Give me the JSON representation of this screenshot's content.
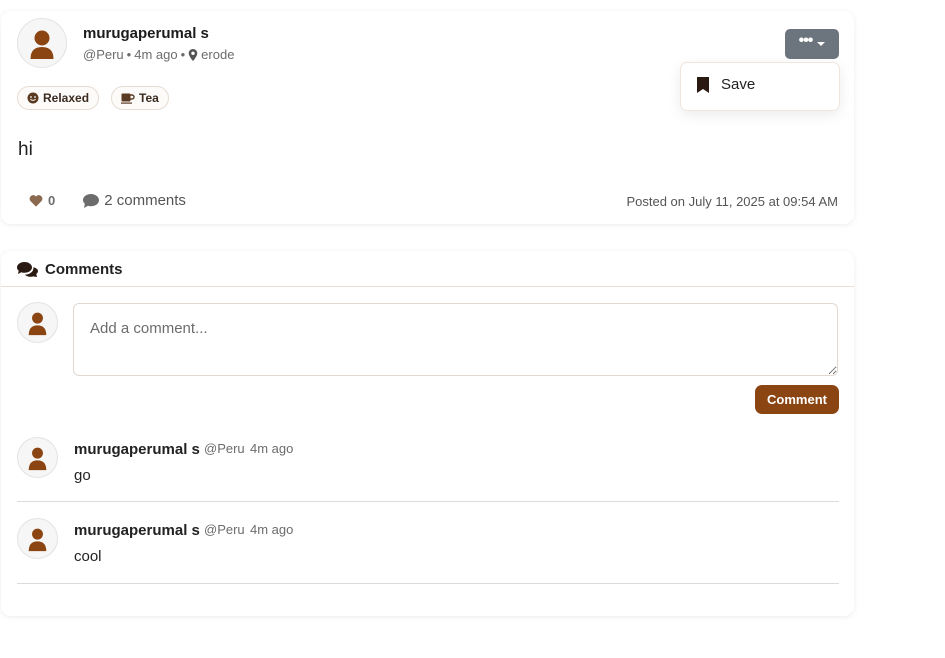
{
  "post": {
    "author_name": "murugaperumal s",
    "handle": "@Peru",
    "time_ago": "4m ago",
    "location": "erode",
    "separator": "•",
    "tags": [
      {
        "label": "Relaxed",
        "icon": "smile-icon"
      },
      {
        "label": "Tea",
        "icon": "mug-icon"
      }
    ],
    "body": "hi",
    "like_count": "0",
    "comments_label": "2 comments",
    "posted_on": "Posted on July 11, 2025 at 09:54 AM",
    "menu": {
      "button_icon": "ellipsis-icon",
      "save_label": "Save",
      "save_icon": "bookmark-icon"
    }
  },
  "comments_section": {
    "title": "Comments",
    "input_placeholder": "Add a comment...",
    "submit_label": "Comment",
    "items": [
      {
        "author_name": "murugaperumal s",
        "handle": "@Peru",
        "time_ago": "4m ago",
        "text": "go"
      },
      {
        "author_name": "murugaperumal s",
        "handle": "@Peru",
        "time_ago": "4m ago",
        "text": "cool"
      }
    ]
  },
  "colors": {
    "accent": "#8b4513",
    "secondary_button": "#6c757d",
    "avatar_fill": "#8b4513",
    "heart": "#8b6a4f"
  }
}
